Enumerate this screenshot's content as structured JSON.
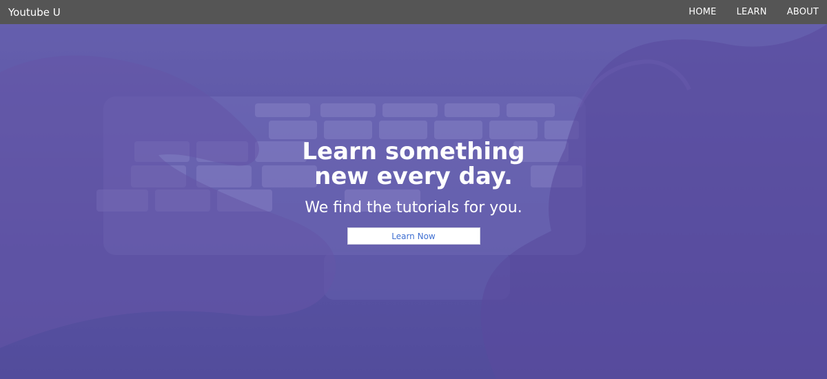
{
  "navbar": {
    "brand": "Youtube U",
    "links": [
      "HOME",
      "LEARN",
      "ABOUT"
    ]
  },
  "hero": {
    "title_line1": "Learn something",
    "title_line2": "new every day.",
    "subtitle": "We find the tutorials for you.",
    "cta_label": "Learn Now"
  },
  "colors": {
    "navbar_bg": "#555555",
    "hero_tint": "#5d5aa3",
    "button_text": "#3f6fd1"
  }
}
